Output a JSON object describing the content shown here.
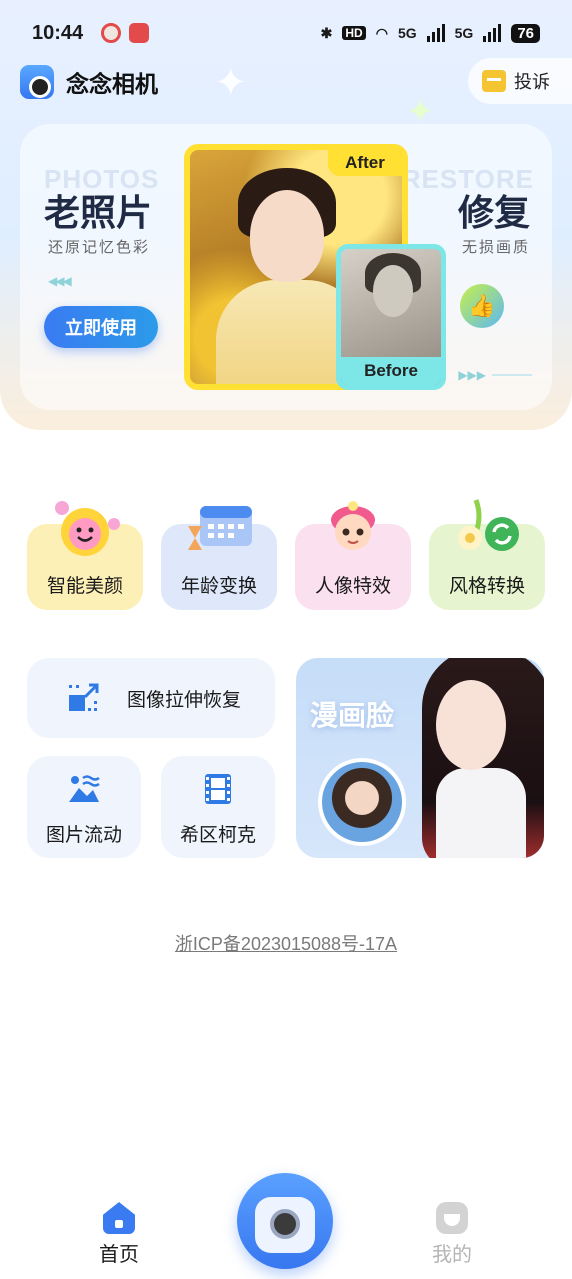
{
  "status_bar": {
    "time": "10:44",
    "hd_label": "HD",
    "net_label": "5G",
    "battery": "76"
  },
  "header": {
    "app_title": "念念相机",
    "complain_label": "投诉"
  },
  "banner": {
    "ghost_left": "PHOTOS",
    "ghost_right": "RESTORE",
    "title_left": "老照片",
    "subtitle_left": "还原记忆色彩",
    "use_button": "立即使用",
    "title_right": "修复",
    "subtitle_right": "无损画质",
    "after_tag": "After",
    "before_tag": "Before"
  },
  "features": [
    {
      "label": "智能美颜",
      "icon": "smile-flower-icon",
      "color": "#fdf0b6"
    },
    {
      "label": "年龄变换",
      "icon": "calendar-hourglass-icon",
      "color": "#dfe8fb"
    },
    {
      "label": "人像特效",
      "icon": "cartoon-girl-icon",
      "color": "#fbe0ef"
    },
    {
      "label": "风格转换",
      "icon": "flower-refresh-icon",
      "color": "#e6f5cf"
    }
  ],
  "tools": {
    "stretch": "图像拉伸恢复",
    "flow": "图片流动",
    "hitchcock": "希区柯克",
    "comic": "漫画脸"
  },
  "footer": {
    "icp": "浙ICP备2023015088号-17A"
  },
  "nav": {
    "home": "首页",
    "mine": "我的"
  },
  "colors": {
    "accent": "#3a7bf2",
    "after_frame": "#ffe033",
    "before_frame": "#7de6e6"
  }
}
